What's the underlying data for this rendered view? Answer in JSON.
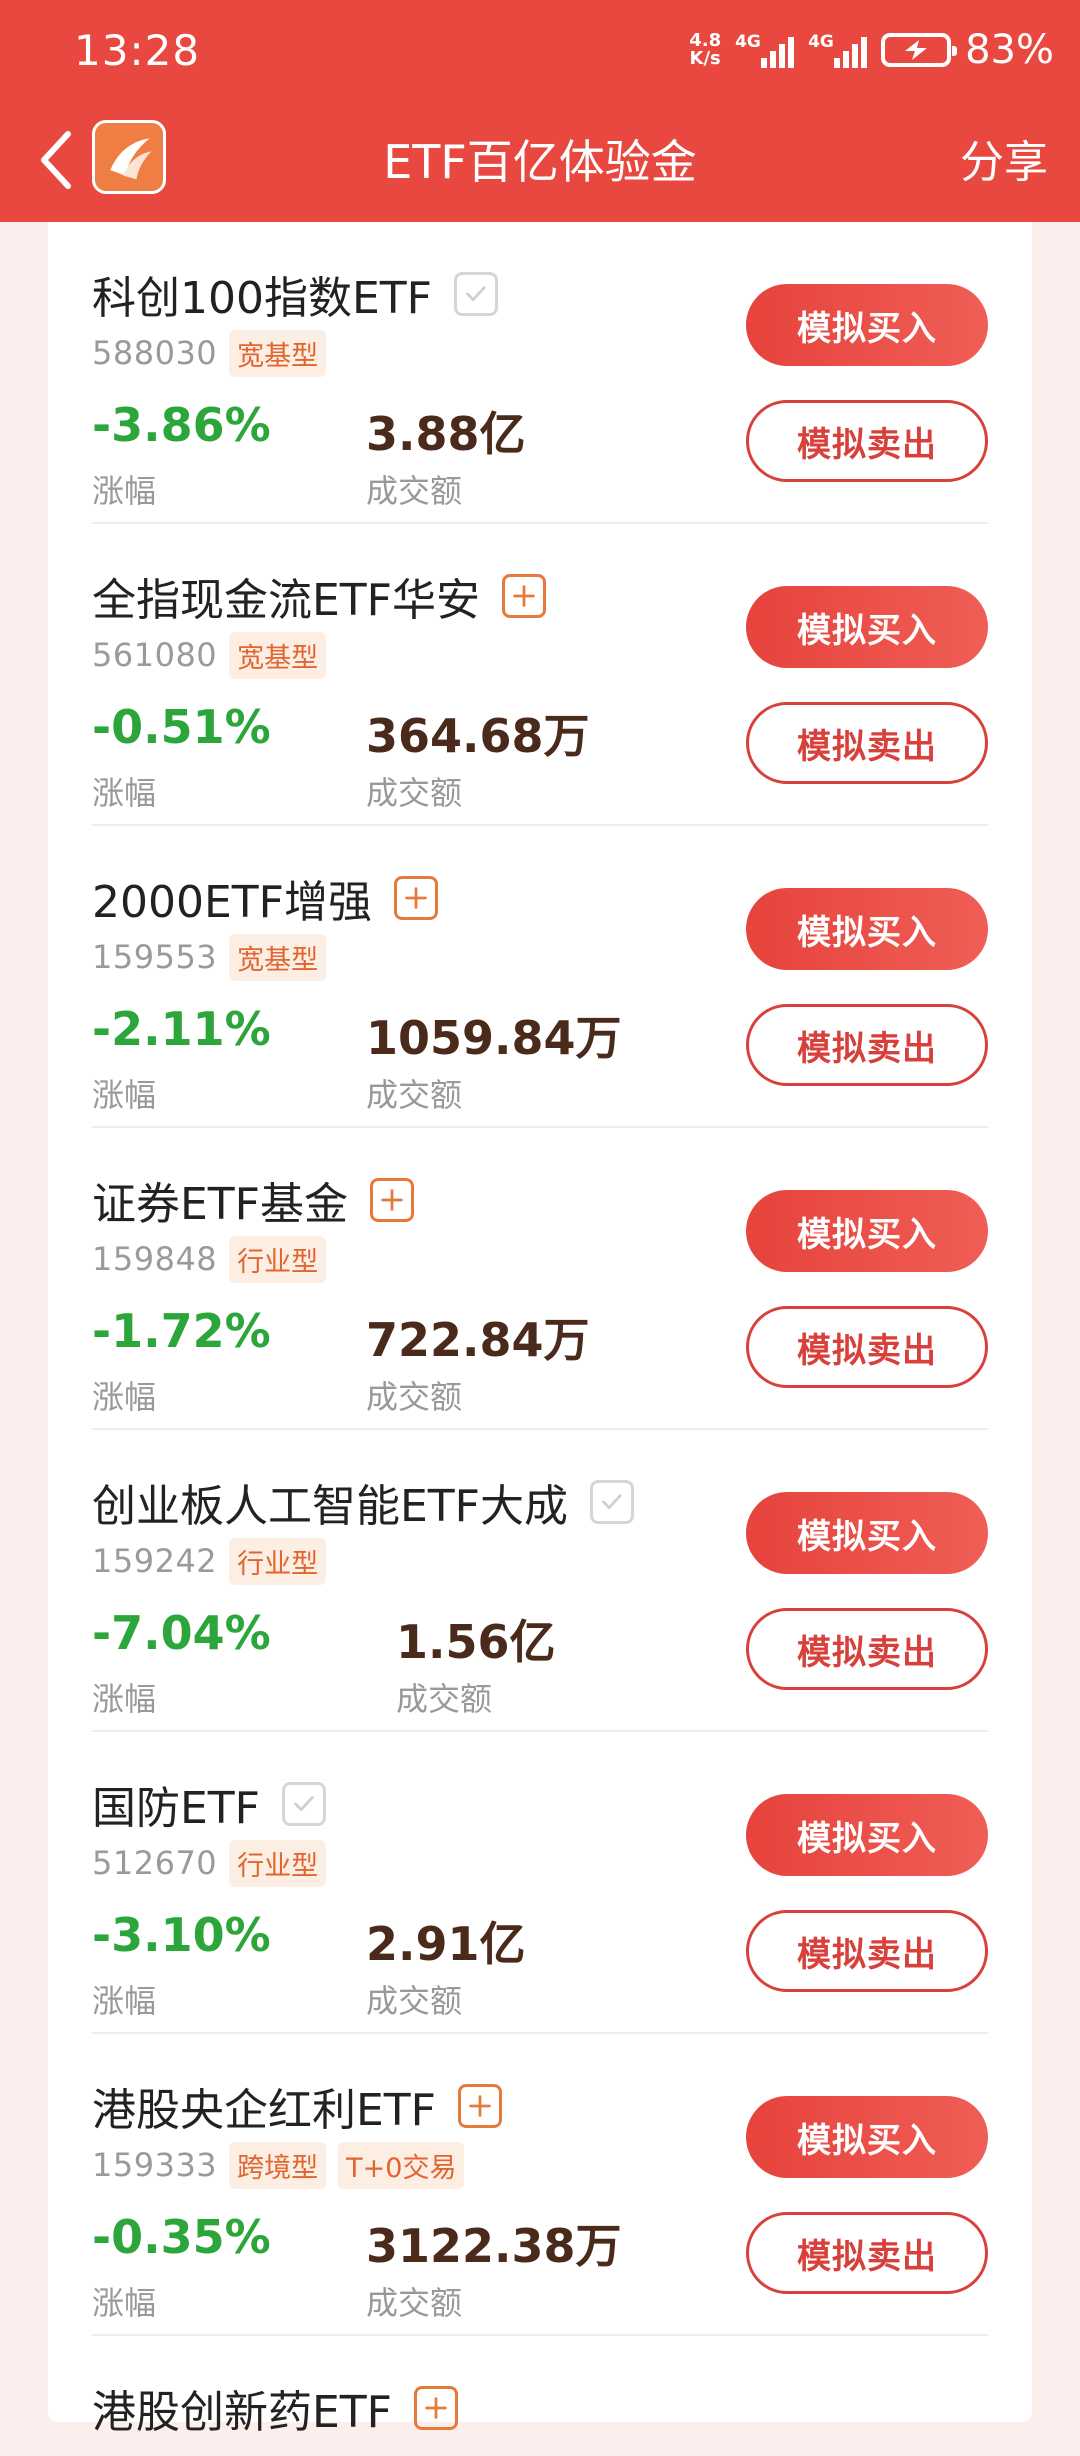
{
  "status_bar": {
    "time": "13:28",
    "net_speed_value": "4.8",
    "net_speed_unit": "K/s",
    "signal1_label": "4G",
    "signal2_label": "4G",
    "battery_percent": "83%"
  },
  "nav": {
    "title": "ETF百亿体验金",
    "share_label": "分享"
  },
  "labels": {
    "change": "涨幅",
    "volume": "成交额",
    "buy": "模拟买入",
    "sell": "模拟卖出"
  },
  "items": [
    {
      "name": "科创100指数ETF",
      "code": "588030",
      "tags": [
        "宽基型"
      ],
      "change": "-3.86%",
      "volume": "3.88亿",
      "added": true
    },
    {
      "name": "全指现金流ETF华安",
      "code": "561080",
      "tags": [
        "宽基型"
      ],
      "change": "-0.51%",
      "volume": "364.68万",
      "added": false
    },
    {
      "name": "2000ETF增强",
      "code": "159553",
      "tags": [
        "宽基型"
      ],
      "change": "-2.11%",
      "volume": "1059.84万",
      "added": false
    },
    {
      "name": "证券ETF基金",
      "code": "159848",
      "tags": [
        "行业型"
      ],
      "change": "-1.72%",
      "volume": "722.84万",
      "added": false
    },
    {
      "name": "创业板人工智能ETF大成",
      "code": "159242",
      "tags": [
        "行业型"
      ],
      "change": "-7.04%",
      "volume": "1.56亿",
      "added": true
    },
    {
      "name": "国防ETF",
      "code": "512670",
      "tags": [
        "行业型"
      ],
      "change": "-3.10%",
      "volume": "2.91亿",
      "added": true
    },
    {
      "name": "港股央企红利ETF",
      "code": "159333",
      "tags": [
        "跨境型",
        "T+0交易"
      ],
      "change": "-0.35%",
      "volume": "3122.38万",
      "added": false
    }
  ],
  "partial_item": {
    "name": "港股创新药ETF"
  },
  "colors": {
    "brand": "#e8483f",
    "positive_change": "#2ca63b",
    "tag_text": "#e0652f"
  }
}
